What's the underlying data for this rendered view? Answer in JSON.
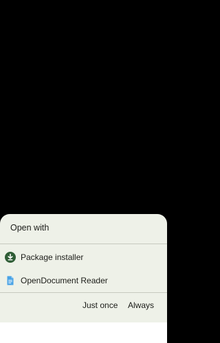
{
  "dialog": {
    "title": "Open with",
    "apps": [
      {
        "label": "Package installer",
        "icon": "download-circle-icon"
      },
      {
        "label": "OpenDocument Reader",
        "icon": "document-icon"
      }
    ],
    "buttons": {
      "just_once": "Just once",
      "always": "Always"
    }
  },
  "colors": {
    "sheet_bg": "#eef1e8",
    "installer_icon": "#2f5d36",
    "document_icon": "#4aa3e6",
    "text": "#1b1c18"
  }
}
